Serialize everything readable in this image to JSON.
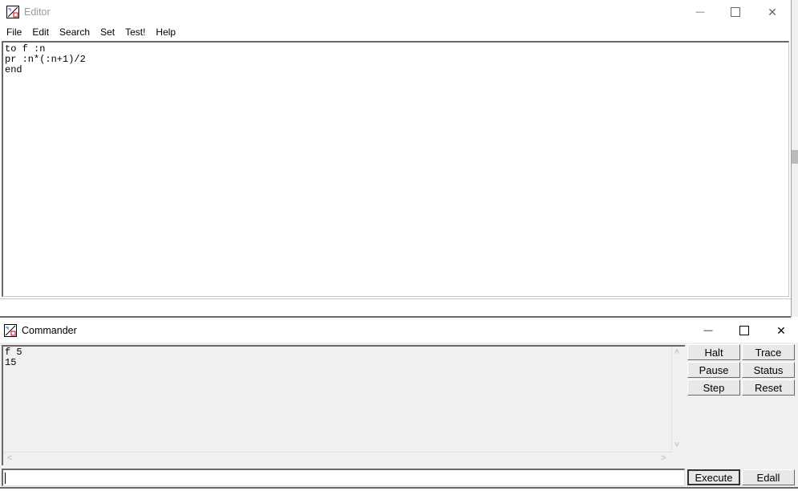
{
  "editor": {
    "title": "Editor",
    "menu": [
      "File",
      "Edit",
      "Search",
      "Set",
      "Test!",
      "Help"
    ],
    "code": "to f :n\npr :n*(:n+1)/2\nend",
    "controls": {
      "minimize": "—",
      "maximize": "☐",
      "close": "✕"
    }
  },
  "commander": {
    "title": "Commander",
    "output": "f 5\n15",
    "buttons": {
      "halt": "Halt",
      "trace": "Trace",
      "pause": "Pause",
      "status": "Status",
      "step": "Step",
      "reset": "Reset",
      "execute": "Execute",
      "edall": "Edall"
    },
    "input_value": "",
    "controls": {
      "minimize": "—",
      "maximize": "☐",
      "close": "✕"
    },
    "scroll_arrows": {
      "up": "˄",
      "down": "˅",
      "left": "<",
      "right": ">"
    }
  }
}
